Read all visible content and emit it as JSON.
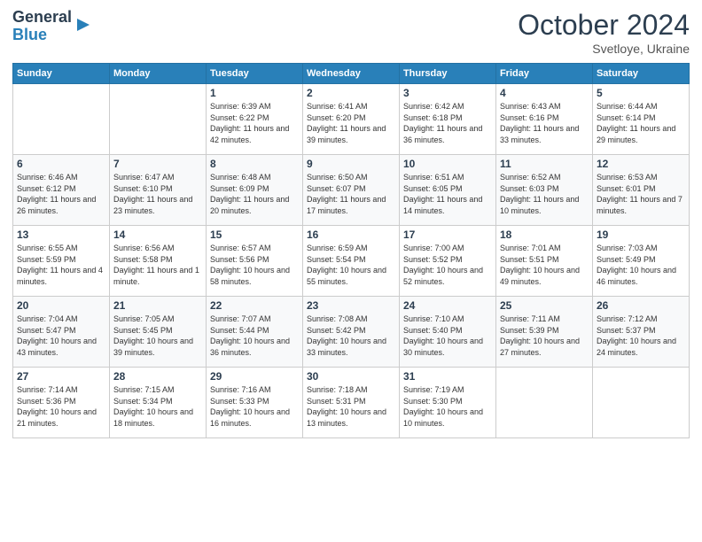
{
  "logo": {
    "line1": "General",
    "line2": "Blue"
  },
  "title": "October 2024",
  "location": "Svetloye, Ukraine",
  "days_of_week": [
    "Sunday",
    "Monday",
    "Tuesday",
    "Wednesday",
    "Thursday",
    "Friday",
    "Saturday"
  ],
  "weeks": [
    [
      {
        "day": "",
        "info": ""
      },
      {
        "day": "",
        "info": ""
      },
      {
        "day": "1",
        "info": "Sunrise: 6:39 AM\nSunset: 6:22 PM\nDaylight: 11 hours and 42 minutes."
      },
      {
        "day": "2",
        "info": "Sunrise: 6:41 AM\nSunset: 6:20 PM\nDaylight: 11 hours and 39 minutes."
      },
      {
        "day": "3",
        "info": "Sunrise: 6:42 AM\nSunset: 6:18 PM\nDaylight: 11 hours and 36 minutes."
      },
      {
        "day": "4",
        "info": "Sunrise: 6:43 AM\nSunset: 6:16 PM\nDaylight: 11 hours and 33 minutes."
      },
      {
        "day": "5",
        "info": "Sunrise: 6:44 AM\nSunset: 6:14 PM\nDaylight: 11 hours and 29 minutes."
      }
    ],
    [
      {
        "day": "6",
        "info": "Sunrise: 6:46 AM\nSunset: 6:12 PM\nDaylight: 11 hours and 26 minutes."
      },
      {
        "day": "7",
        "info": "Sunrise: 6:47 AM\nSunset: 6:10 PM\nDaylight: 11 hours and 23 minutes."
      },
      {
        "day": "8",
        "info": "Sunrise: 6:48 AM\nSunset: 6:09 PM\nDaylight: 11 hours and 20 minutes."
      },
      {
        "day": "9",
        "info": "Sunrise: 6:50 AM\nSunset: 6:07 PM\nDaylight: 11 hours and 17 minutes."
      },
      {
        "day": "10",
        "info": "Sunrise: 6:51 AM\nSunset: 6:05 PM\nDaylight: 11 hours and 14 minutes."
      },
      {
        "day": "11",
        "info": "Sunrise: 6:52 AM\nSunset: 6:03 PM\nDaylight: 11 hours and 10 minutes."
      },
      {
        "day": "12",
        "info": "Sunrise: 6:53 AM\nSunset: 6:01 PM\nDaylight: 11 hours and 7 minutes."
      }
    ],
    [
      {
        "day": "13",
        "info": "Sunrise: 6:55 AM\nSunset: 5:59 PM\nDaylight: 11 hours and 4 minutes."
      },
      {
        "day": "14",
        "info": "Sunrise: 6:56 AM\nSunset: 5:58 PM\nDaylight: 11 hours and 1 minute."
      },
      {
        "day": "15",
        "info": "Sunrise: 6:57 AM\nSunset: 5:56 PM\nDaylight: 10 hours and 58 minutes."
      },
      {
        "day": "16",
        "info": "Sunrise: 6:59 AM\nSunset: 5:54 PM\nDaylight: 10 hours and 55 minutes."
      },
      {
        "day": "17",
        "info": "Sunrise: 7:00 AM\nSunset: 5:52 PM\nDaylight: 10 hours and 52 minutes."
      },
      {
        "day": "18",
        "info": "Sunrise: 7:01 AM\nSunset: 5:51 PM\nDaylight: 10 hours and 49 minutes."
      },
      {
        "day": "19",
        "info": "Sunrise: 7:03 AM\nSunset: 5:49 PM\nDaylight: 10 hours and 46 minutes."
      }
    ],
    [
      {
        "day": "20",
        "info": "Sunrise: 7:04 AM\nSunset: 5:47 PM\nDaylight: 10 hours and 43 minutes."
      },
      {
        "day": "21",
        "info": "Sunrise: 7:05 AM\nSunset: 5:45 PM\nDaylight: 10 hours and 39 minutes."
      },
      {
        "day": "22",
        "info": "Sunrise: 7:07 AM\nSunset: 5:44 PM\nDaylight: 10 hours and 36 minutes."
      },
      {
        "day": "23",
        "info": "Sunrise: 7:08 AM\nSunset: 5:42 PM\nDaylight: 10 hours and 33 minutes."
      },
      {
        "day": "24",
        "info": "Sunrise: 7:10 AM\nSunset: 5:40 PM\nDaylight: 10 hours and 30 minutes."
      },
      {
        "day": "25",
        "info": "Sunrise: 7:11 AM\nSunset: 5:39 PM\nDaylight: 10 hours and 27 minutes."
      },
      {
        "day": "26",
        "info": "Sunrise: 7:12 AM\nSunset: 5:37 PM\nDaylight: 10 hours and 24 minutes."
      }
    ],
    [
      {
        "day": "27",
        "info": "Sunrise: 7:14 AM\nSunset: 5:36 PM\nDaylight: 10 hours and 21 minutes."
      },
      {
        "day": "28",
        "info": "Sunrise: 7:15 AM\nSunset: 5:34 PM\nDaylight: 10 hours and 18 minutes."
      },
      {
        "day": "29",
        "info": "Sunrise: 7:16 AM\nSunset: 5:33 PM\nDaylight: 10 hours and 16 minutes."
      },
      {
        "day": "30",
        "info": "Sunrise: 7:18 AM\nSunset: 5:31 PM\nDaylight: 10 hours and 13 minutes."
      },
      {
        "day": "31",
        "info": "Sunrise: 7:19 AM\nSunset: 5:30 PM\nDaylight: 10 hours and 10 minutes."
      },
      {
        "day": "",
        "info": ""
      },
      {
        "day": "",
        "info": ""
      }
    ]
  ]
}
